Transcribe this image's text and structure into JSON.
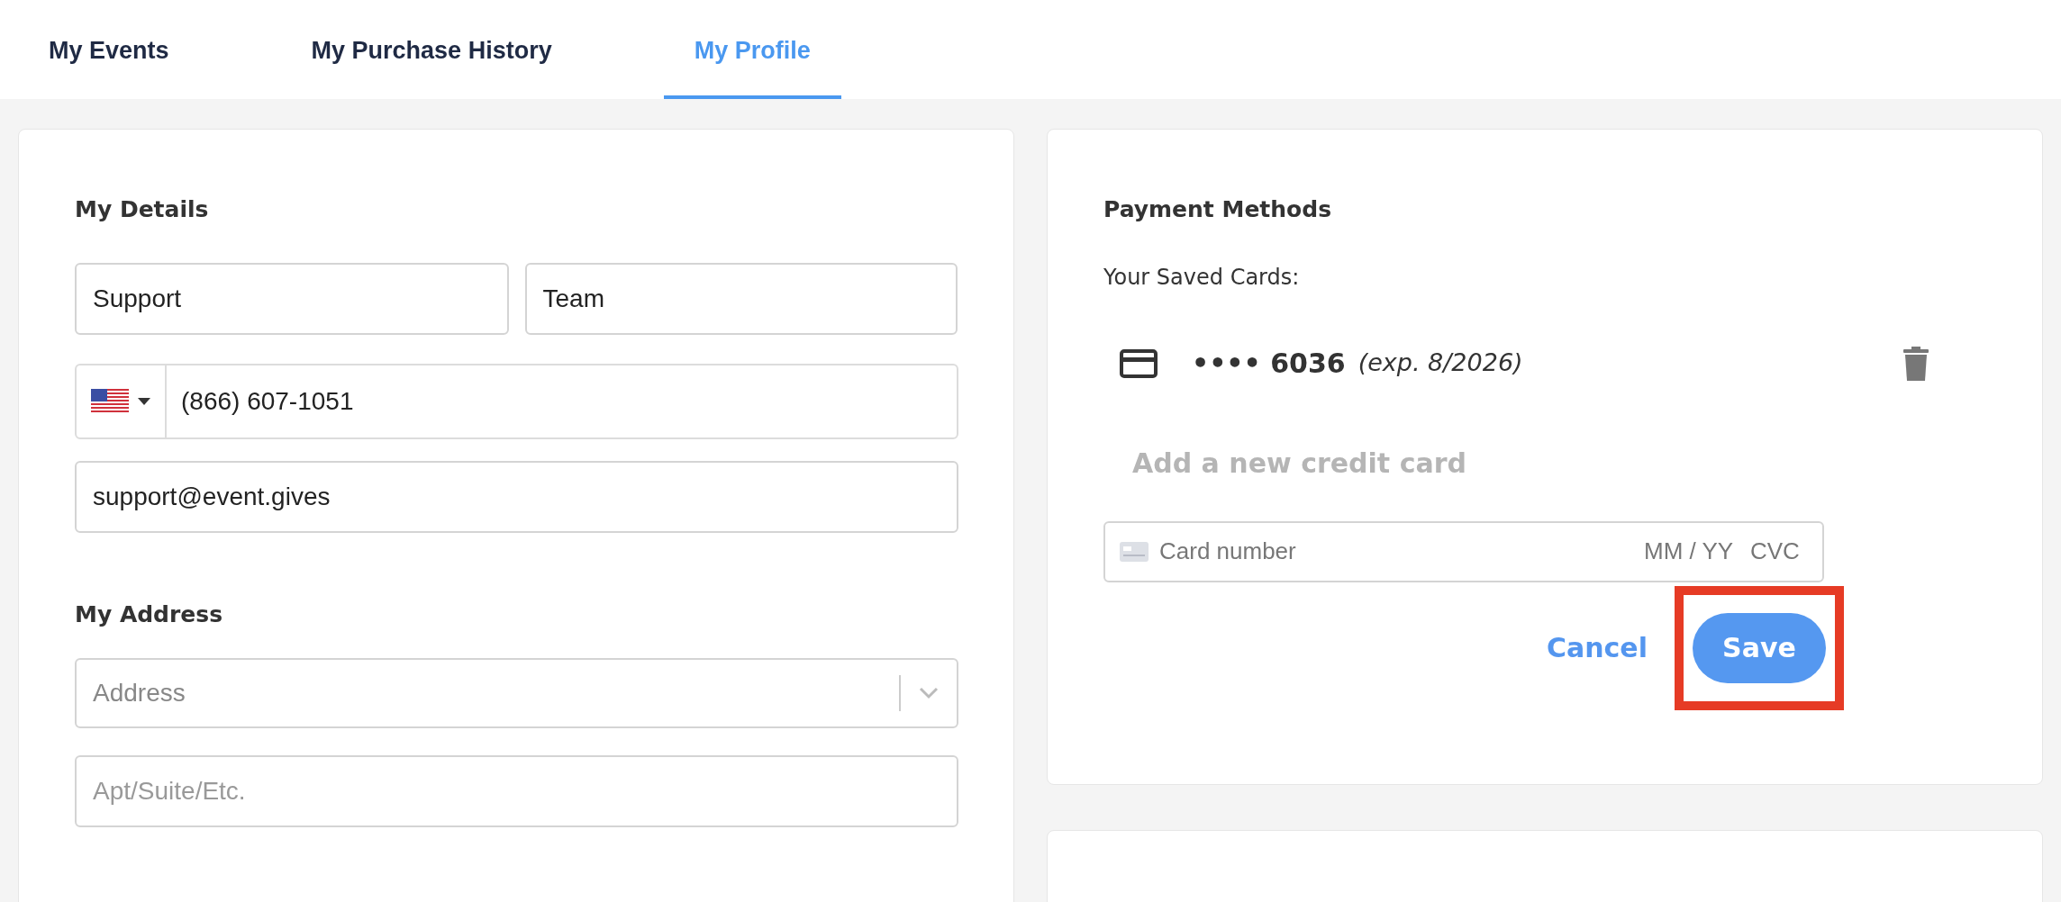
{
  "tabs": [
    {
      "label": "My Events",
      "selected": false
    },
    {
      "label": "My Purchase History",
      "selected": false
    },
    {
      "label": "My Profile",
      "selected": true
    }
  ],
  "details": {
    "title": "My Details",
    "first_name": "Support",
    "last_name": "Team",
    "phone": "(866) 607-1051",
    "email": "support@event.gives"
  },
  "address": {
    "title": "My Address",
    "address_placeholder": "Address",
    "apt_placeholder": "Apt/Suite/Etc."
  },
  "payment": {
    "title": "Payment Methods",
    "saved_label": "Your Saved Cards:",
    "cards": [
      {
        "number": "•••• 6036",
        "expiry": "(exp. 8/2026)"
      }
    ],
    "add_label": "Add a new credit card",
    "card_placeholder": "Card number",
    "expiry_placeholder": "MM / YY",
    "cvc_placeholder": "CVC",
    "cancel": "Cancel",
    "save": "Save"
  }
}
